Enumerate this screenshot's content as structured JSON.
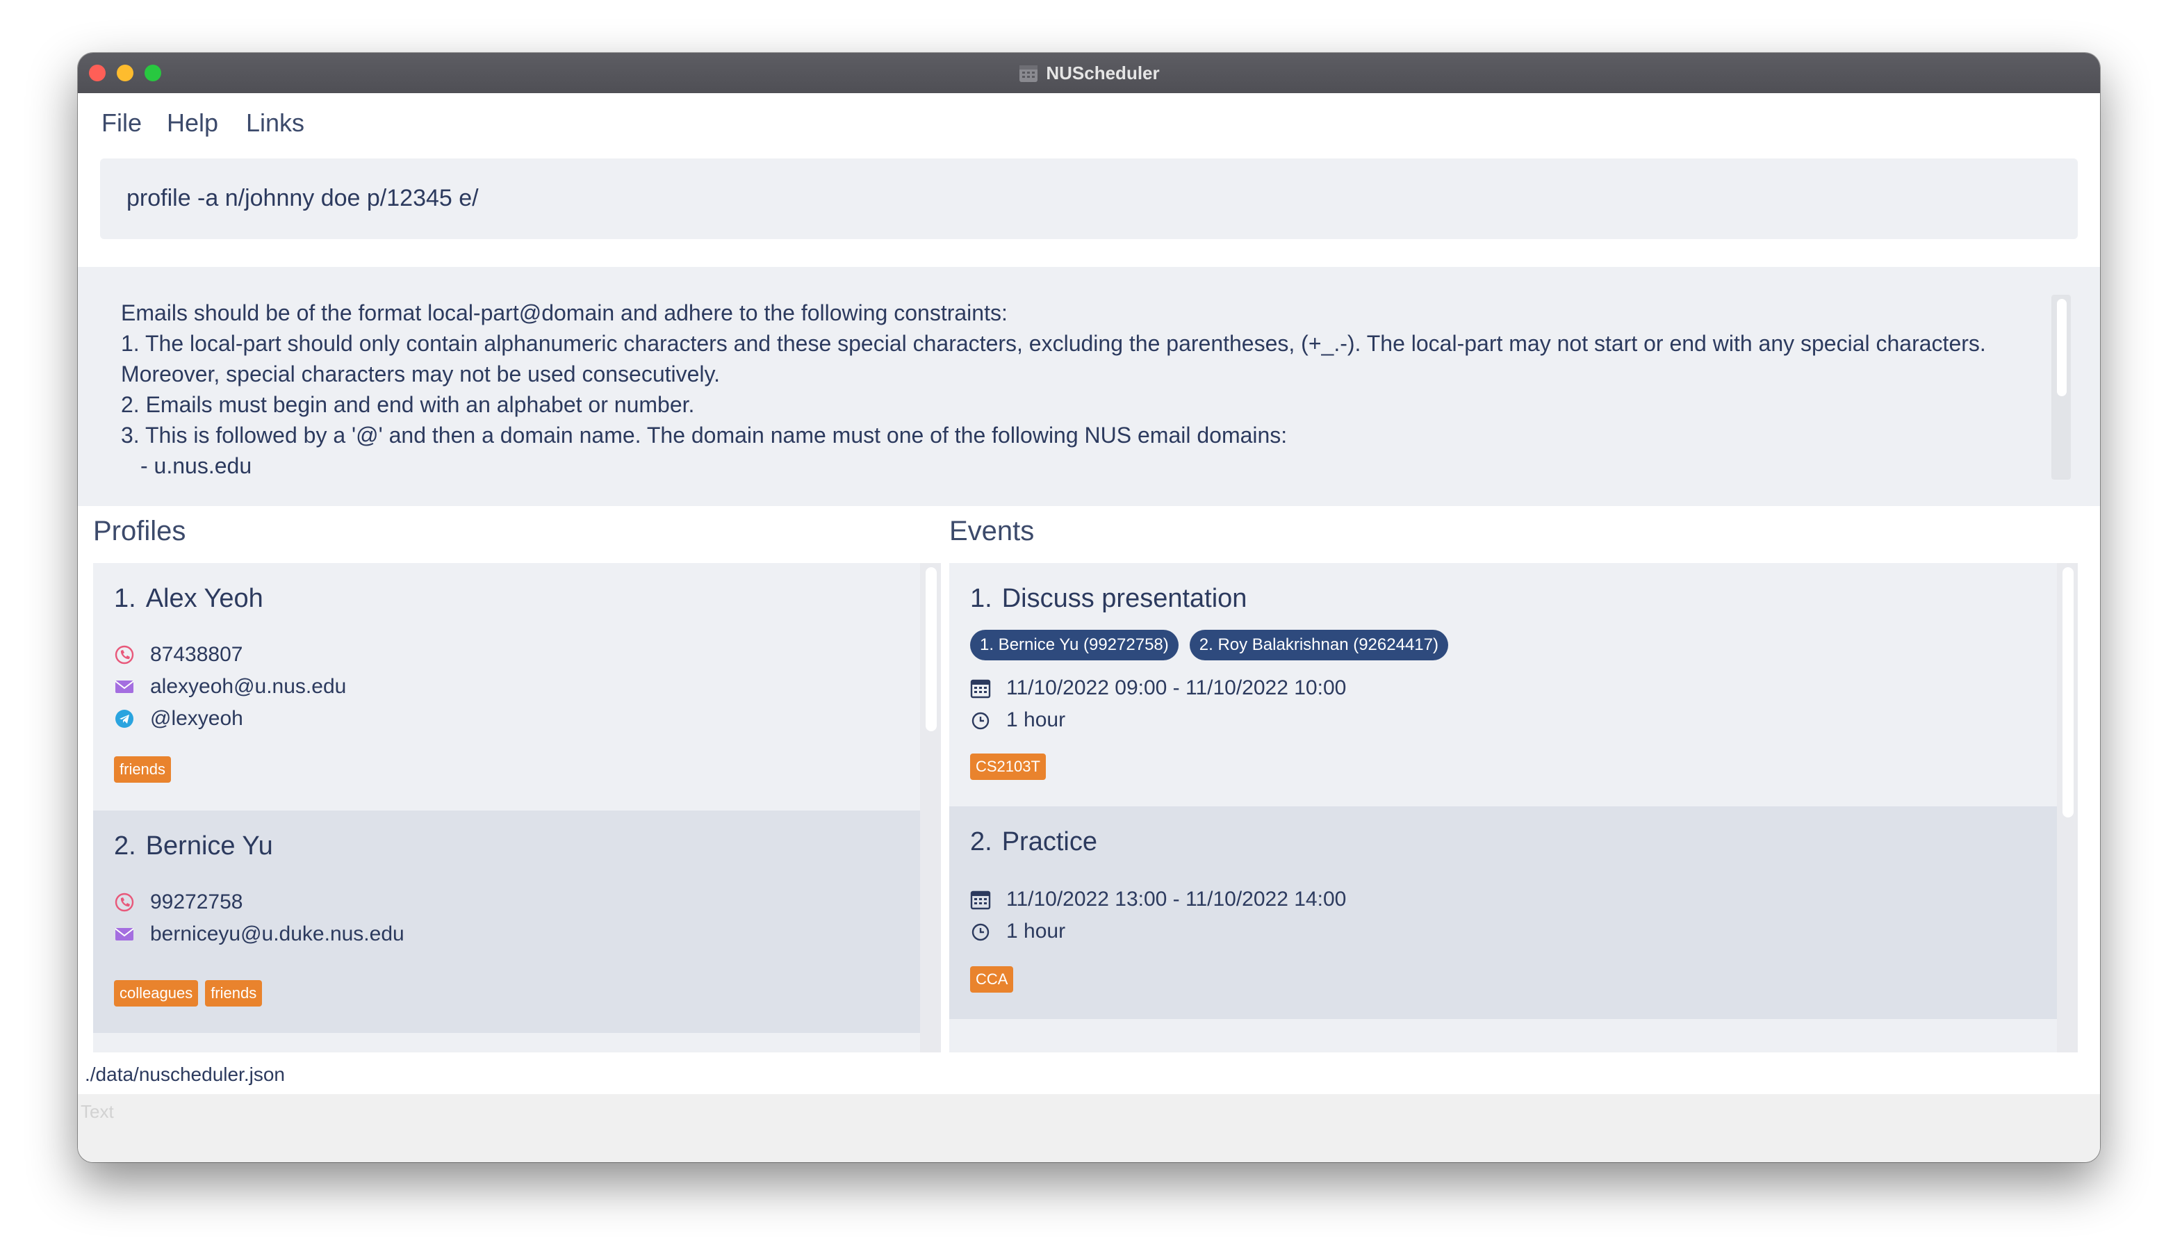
{
  "window": {
    "title": "NUScheduler"
  },
  "menu": {
    "items": [
      "File",
      "Help",
      "Links"
    ]
  },
  "command": {
    "value": "profile -a n/johnny doe p/12345 e/"
  },
  "result": {
    "lines": [
      "Emails should be of the format local-part@domain and adhere to the following constraints:",
      "1. The local-part should only contain alphanumeric characters and these special characters, excluding the parentheses, (+_.-). The local-part may not start or end with any special characters.",
      "Moreover, special characters may not be used consecutively.",
      "2. Emails must begin and end with an alphabet or number.",
      "3. This is followed by a '@' and then a domain name. The domain name must one of the following NUS email domains:",
      "- u.nus.edu"
    ]
  },
  "profiles": {
    "title": "Profiles",
    "items": [
      {
        "index": "1.",
        "name": "Alex Yeoh",
        "phone": "87438807",
        "email": "alexyeoh@u.nus.edu",
        "telegram": "@lexyeoh",
        "tags": [
          "friends"
        ]
      },
      {
        "index": "2.",
        "name": "Bernice Yu",
        "phone": "99272758",
        "email": "berniceyu@u.duke.nus.edu",
        "tags": [
          "colleagues",
          "friends"
        ]
      }
    ]
  },
  "events": {
    "title": "Events",
    "items": [
      {
        "index": "1.",
        "title": "Discuss presentation",
        "attendees": [
          "1. Bernice Yu (99272758)",
          "2. Roy Balakrishnan (92624417)"
        ],
        "datetime": "11/10/2022 09:00 - 11/10/2022 10:00",
        "duration": "1 hour",
        "tags": [
          "CS2103T"
        ]
      },
      {
        "index": "2.",
        "title": "Practice",
        "datetime": "11/10/2022 13:00 - 11/10/2022 14:00",
        "duration": "1 hour",
        "tags": [
          "CCA"
        ]
      }
    ]
  },
  "status": {
    "path": "./data/nuscheduler.json",
    "ghost_text": "Text"
  },
  "colors": {
    "accent_dark": "#2e4a7d",
    "tag": "#e9832d",
    "phone_icon": "#e8587a",
    "email_icon": "#a46ee0",
    "telegram_icon": "#2aa4df"
  },
  "icons": [
    "calendar-icon",
    "phone-icon",
    "email-icon",
    "telegram-icon",
    "clock-icon"
  ]
}
